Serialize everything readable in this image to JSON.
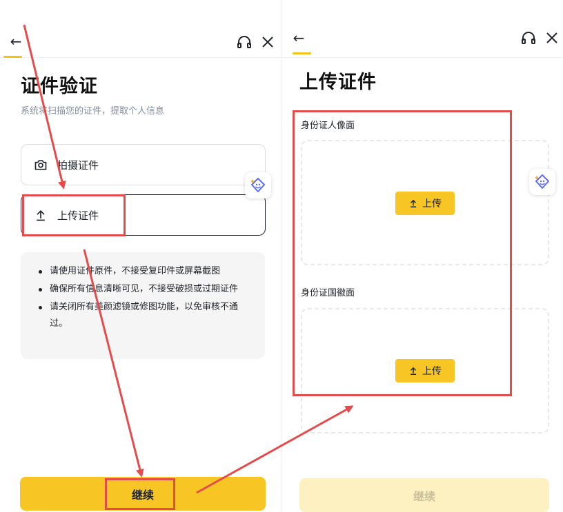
{
  "left": {
    "title": "证件验证",
    "subtitle": "系统将扫描您的证件，提取个人信息",
    "options": [
      {
        "label": "拍摄证件",
        "icon": "camera-icon"
      },
      {
        "label": "上传证件",
        "icon": "upload-arrow-icon"
      }
    ],
    "tips": [
      "请使用证件原件，不接受复印件或屏幕截图",
      "确保所有信息清晰可见，不接受破损或过期证件",
      "请关闭所有美颜滤镜或修图功能，以免审核不通过。"
    ],
    "continue_label": "继续"
  },
  "right": {
    "title": "上传证件",
    "front_label": "身份证人像面",
    "back_label": "身份证国徽面",
    "upload_label": "上传",
    "continue_label": "继续"
  },
  "colors": {
    "accent": "#f7c625",
    "accent_disabled": "#fdf1c2",
    "annotation": "#e64b4b",
    "text": "#1e2329",
    "muted": "#848e9c"
  },
  "icons": {
    "back": "back-arrow-icon",
    "support": "headset-icon",
    "close": "close-icon",
    "assistant": "ai-face-icon"
  }
}
